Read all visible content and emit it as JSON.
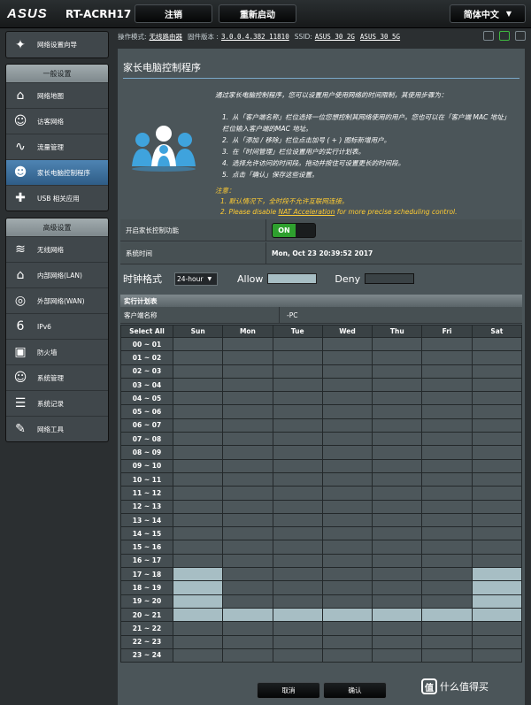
{
  "topbar": {
    "logo": "ASUS",
    "model": "RT-ACRH17",
    "logout_label": "注销",
    "reboot_label": "重新启动",
    "lang_label": "简体中文"
  },
  "infobar": {
    "mode_label": "操作模式:",
    "mode_value": "无线路由器",
    "fw_label": "固件版本 :",
    "fw_value": "3.0.0.4.382_11810",
    "ssid_label": "SSID:",
    "ssid_2g": "ASUS_30_2G",
    "ssid_5g": "ASUS_30_5G"
  },
  "sidebar": {
    "wizard": {
      "label": "网络设置向导",
      "icon": "wand-icon"
    },
    "general_head": "一般设置",
    "general_items": [
      {
        "label": "网络地图",
        "icon": "network-map-icon"
      },
      {
        "label": "访客网络",
        "icon": "guest-network-icon"
      },
      {
        "label": "流量管理",
        "icon": "traffic-icon"
      },
      {
        "label": "家长电脑控制程序",
        "icon": "parental-control-icon",
        "active": true
      },
      {
        "label": "USB 相关应用",
        "icon": "puzzle-icon"
      }
    ],
    "advanced_head": "高级设置",
    "advanced_items": [
      {
        "label": "无线网络",
        "icon": "wifi-icon"
      },
      {
        "label": "内部网络(LAN)",
        "icon": "home-icon"
      },
      {
        "label": "外部网络(WAN)",
        "icon": "globe-icon"
      },
      {
        "label": "IPv6",
        "icon": "ipv6-icon"
      },
      {
        "label": "防火墙",
        "icon": "firewall-icon"
      },
      {
        "label": "系统管理",
        "icon": "admin-icon"
      },
      {
        "label": "系统记录",
        "icon": "log-icon"
      },
      {
        "label": "网络工具",
        "icon": "tools-icon"
      }
    ]
  },
  "main": {
    "title": "家长电脑控制程序",
    "intro": "通过家长电脑控制程序，您可以设置用户使用网络的时间限制，其使用步骤为：",
    "steps": [
      "从「客户端名称」栏位选择一位您想控制其网络使用的用户。您也可以在「客户端 MAC 地址」栏位输入客户端的MAC 地址。",
      "从「添加 / 移除」栏位点击加号 ( + ) 图标新增用户。",
      "在「时间管理」栏位设置用户的实行计划表。",
      "选择允许访问的时间段。拖动并按住可设置更长的时间段。",
      "点击「确认」保存这些设置。"
    ],
    "notes_label": "注意：",
    "note1": "1. 默认情况下，全时段不允许互联网连接。",
    "note2_pre": "2. Please disable ",
    "note2_link": "NAT Acceleration",
    "note2_post": " for more precise scheduling control.",
    "enable_label": "开启家长控制功能",
    "enable_value": "ON",
    "systime_label": "系统时间",
    "systime_value": "Mon, Oct 23 20:39:52 2017",
    "clock_label": "时钟格式",
    "clock_value": "24-hour",
    "allow_label": "Allow",
    "deny_label": "Deny",
    "sched_head": "实行计划表",
    "client_label": "客户端名称",
    "client_value": "-PC",
    "cancel_label": "取消",
    "ok_label": "确认"
  },
  "schedule": {
    "select_all": "Select All",
    "days": [
      "Sun",
      "Mon",
      "Tue",
      "Wed",
      "Thu",
      "Fri",
      "Sat"
    ],
    "hours": [
      "00 ~ 01",
      "01 ~ 02",
      "02 ~ 03",
      "03 ~ 04",
      "04 ~ 05",
      "05 ~ 06",
      "06 ~ 07",
      "07 ~ 08",
      "08 ~ 09",
      "09 ~ 10",
      "10 ~ 11",
      "11 ~ 12",
      "12 ~ 13",
      "13 ~ 14",
      "14 ~ 15",
      "15 ~ 16",
      "16 ~ 17",
      "17 ~ 18",
      "18 ~ 19",
      "19 ~ 20",
      "20 ~ 21",
      "21 ~ 22",
      "22 ~ 23",
      "23 ~ 24"
    ],
    "allowed": {
      "Sun": [
        "17 ~ 18",
        "18 ~ 19",
        "19 ~ 20",
        "20 ~ 21"
      ],
      "Mon": [
        "20 ~ 21"
      ],
      "Tue": [
        "20 ~ 21"
      ],
      "Wed": [
        "20 ~ 21"
      ],
      "Thu": [
        "20 ~ 21"
      ],
      "Fri": [
        "20 ~ 21"
      ],
      "Sat": [
        "17 ~ 18",
        "18 ~ 19",
        "19 ~ 20",
        "20 ~ 21"
      ]
    }
  },
  "watermark": {
    "box": "值",
    "text": "什么值得买"
  },
  "colors": {
    "allow": "#a7bec4",
    "deny": "#4d575b",
    "accent": "#2ea02e"
  }
}
